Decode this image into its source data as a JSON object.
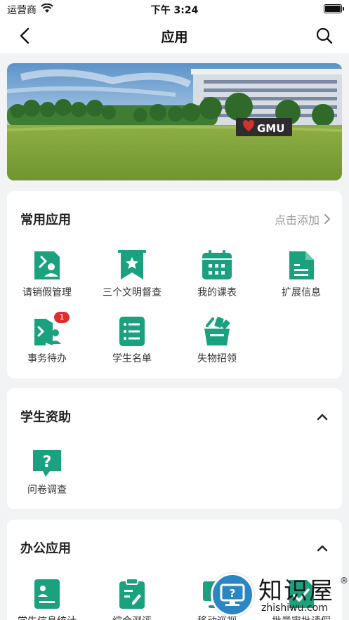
{
  "status_bar": {
    "carrier": "运营商",
    "time": "下午 3:24"
  },
  "nav": {
    "title": "应用"
  },
  "banner": {
    "sign": "GMU"
  },
  "common_apps": {
    "title": "常用应用",
    "action": "点击添加",
    "items": [
      {
        "label": "请销假管理",
        "icon": "leave-icon"
      },
      {
        "label": "三个文明督查",
        "icon": "bookmark-star-icon"
      },
      {
        "label": "我的课表",
        "icon": "calendar-icon"
      },
      {
        "label": "扩展信息",
        "icon": "document-icon"
      },
      {
        "label": "事务待办",
        "icon": "door-person-icon",
        "badge": "1"
      },
      {
        "label": "学生名单",
        "icon": "list-icon"
      },
      {
        "label": "失物招领",
        "icon": "basket-icon"
      }
    ]
  },
  "student_aid": {
    "title": "学生资助",
    "items": [
      {
        "label": "问卷调查",
        "icon": "question-icon"
      }
    ]
  },
  "office_apps": {
    "title": "办公应用",
    "items": [
      {
        "label": "学生信息统计",
        "icon": "student-info-icon"
      },
      {
        "label": "综合测评",
        "icon": "clipboard-icon"
      },
      {
        "label": "移动巡视",
        "icon": "monitor-icon"
      },
      {
        "label": "批量审批请假",
        "icon": "approval-icon"
      }
    ]
  },
  "watermark": {
    "cn": "知识屋",
    "en": "zhishiwu.com",
    "mark": "®"
  },
  "colors": {
    "accent": "#1aa17e",
    "badge": "#e02e2e"
  }
}
